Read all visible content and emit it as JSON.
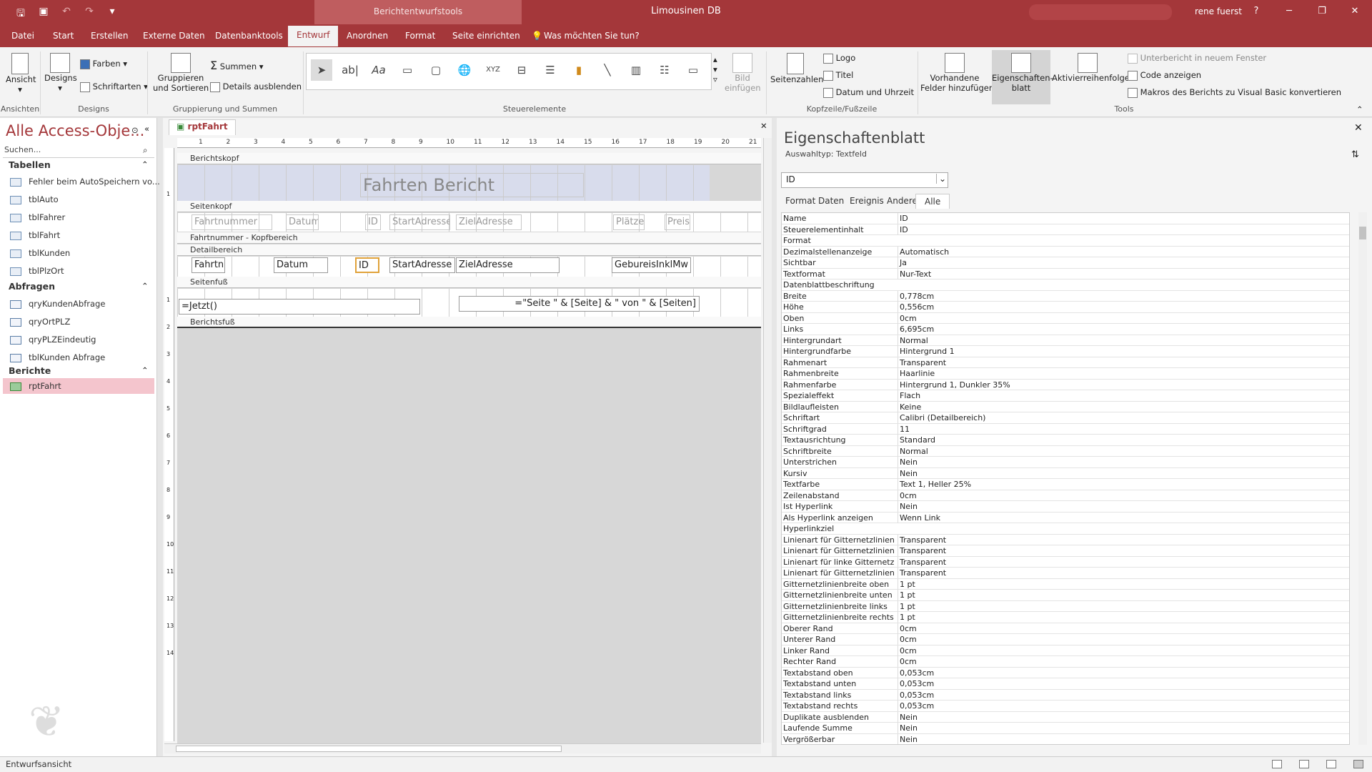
{
  "titlebar": {
    "context_tool": "Berichtentwurfstools",
    "app_title": "Limousinen DB",
    "user": "rene fuerst",
    "help": "?",
    "minimize": "─",
    "restore": "❐",
    "close": "✕"
  },
  "qat": {
    "save": "🖫",
    "form": "▣",
    "undo": "↶",
    "redo": "↷",
    "more": "▾"
  },
  "ribbon_tabs": [
    "Datei",
    "Start",
    "Erstellen",
    "Externe Daten",
    "Datenbanktools",
    "Entwurf",
    "Anordnen",
    "Format",
    "Seite einrichten"
  ],
  "active_tab": "Entwurf",
  "tell_me": "Was möchten Sie tun?",
  "ribbon": {
    "ansicht": "Ansicht",
    "designs": "Designs",
    "farben": "Farben",
    "schriftarten": "Schriftarten",
    "gruppieren": "Gruppieren\nund Sortieren",
    "summen": "Summen",
    "details": "Details ausblenden",
    "bild": "Bild\neinfügen",
    "seitenzahlen": "Seitenzahlen",
    "logo": "Logo",
    "titel": "Titel",
    "datum_uhrzeit": "Datum und Uhrzeit",
    "vorhandene": "Vorhandene\nFelder hinzufügen",
    "eigenschaftenblatt": "Eigenschaften-\nblatt",
    "aktivierreihenfolge": "Aktivierreihenfolge",
    "unterbericht": "Unterbericht in neuem Fenster",
    "code": "Code anzeigen",
    "makros": "Makros des Berichts zu Visual Basic konvertieren",
    "groups": {
      "ansichten": "Ansichten",
      "designs": "Designs",
      "gruppierung": "Gruppierung und Summen",
      "steuerelemente": "Steuerelemente",
      "kopfzeile": "Kopfzeile/Fußzeile",
      "tools": "Tools"
    }
  },
  "nav": {
    "title": "Alle Access-Obje...",
    "search_placeholder": "Suchen...",
    "tabellen_header": "Tabellen",
    "tabellen": [
      "Fehler beim AutoSpeichern vo...",
      "tblAuto",
      "tblFahrer",
      "tblFahrt",
      "tblKunden",
      "tblPlzOrt"
    ],
    "abfragen_header": "Abfragen",
    "abfragen": [
      "qryKundenAbfrage",
      "qryOrtPLZ",
      "qryPLZEindeutig",
      "tblKunden Abfrage"
    ],
    "berichte_header": "Berichte",
    "berichte": [
      "rptFahrt"
    ]
  },
  "document": {
    "tab": "rptFahrt",
    "sections": {
      "berichtskopf": "Berichtskopf",
      "seitenkopf": "Seitenkopf",
      "fahrtnummer_kopf": "Fahrtnummer - Kopfbereich",
      "detail": "Detailbereich",
      "seitenfuss": "Seitenfuß",
      "berichtsfuss": "Berichtsfuß"
    },
    "report_title": "Fahrten Bericht",
    "header_labels": [
      "Fahrtnummer",
      "Datum",
      "ID",
      "StartAdresse",
      "ZielAdresse",
      "Plätze",
      "Preis"
    ],
    "detail_fields": [
      "Fahrtn",
      "Datum",
      "ID",
      "StartAdresse",
      "ZielAdresse",
      "GebureisInklMw"
    ],
    "footer_now": "=Jetzt()",
    "footer_page": "=\"Seite \" & [Seite] & \" von \" & [Seiten]",
    "ruler_numbers": [
      "1",
      "2",
      "3",
      "4",
      "5",
      "6",
      "7",
      "8",
      "9",
      "10",
      "11",
      "12",
      "13",
      "14",
      "15",
      "16",
      "17",
      "18",
      "19",
      "20",
      "21"
    ],
    "ruler_v": [
      "1",
      "1",
      "2",
      "3",
      "4",
      "5",
      "6",
      "7",
      "8",
      "9",
      "10",
      "11",
      "12",
      "13",
      "14"
    ]
  },
  "properties": {
    "title": "Eigenschaftenblatt",
    "selection_type": "Auswahltyp:  Textfeld",
    "selected": "ID",
    "tabs": [
      "Format",
      "Daten",
      "Ereignis",
      "Andere",
      "Alle"
    ],
    "active_tab": "Alle",
    "rows": [
      [
        "Name",
        "ID"
      ],
      [
        "Steuerelementinhalt",
        "ID"
      ],
      [
        "Format",
        ""
      ],
      [
        "Dezimalstellenanzeige",
        "Automatisch"
      ],
      [
        "Sichtbar",
        "Ja"
      ],
      [
        "Textformat",
        "Nur-Text"
      ],
      [
        "Datenblattbeschriftung",
        ""
      ],
      [
        "Breite",
        "0,778cm"
      ],
      [
        "Höhe",
        "0,556cm"
      ],
      [
        "Oben",
        "0cm"
      ],
      [
        "Links",
        "6,695cm"
      ],
      [
        "Hintergrundart",
        "Normal"
      ],
      [
        "Hintergrundfarbe",
        "Hintergrund 1"
      ],
      [
        "Rahmenart",
        "Transparent"
      ],
      [
        "Rahmenbreite",
        "Haarlinie"
      ],
      [
        "Rahmenfarbe",
        "Hintergrund 1, Dunkler 35%"
      ],
      [
        "Spezialeffekt",
        "Flach"
      ],
      [
        "Bildlaufleisten",
        "Keine"
      ],
      [
        "Schriftart",
        "Calibri (Detailbereich)"
      ],
      [
        "Schriftgrad",
        "11"
      ],
      [
        "Textausrichtung",
        "Standard"
      ],
      [
        "Schriftbreite",
        "Normal"
      ],
      [
        "Unterstrichen",
        "Nein"
      ],
      [
        "Kursiv",
        "Nein"
      ],
      [
        "Textfarbe",
        "Text 1, Heller 25%"
      ],
      [
        "Zeilenabstand",
        "0cm"
      ],
      [
        "Ist Hyperlink",
        "Nein"
      ],
      [
        "Als Hyperlink anzeigen",
        "Wenn Link"
      ],
      [
        "Hyperlinkziel",
        ""
      ],
      [
        "Linienart für Gitternetzlinien o",
        "Transparent"
      ],
      [
        "Linienart für Gitternetzlinien u",
        "Transparent"
      ],
      [
        "Linienart für linke Gitternetzlir",
        "Transparent"
      ],
      [
        "Linienart für Gitternetzlinien re",
        "Transparent"
      ],
      [
        "Gitternetzlinienbreite oben",
        "1 pt"
      ],
      [
        "Gitternetzlinienbreite unten",
        "1 pt"
      ],
      [
        "Gitternetzlinienbreite links",
        "1 pt"
      ],
      [
        "Gitternetzlinienbreite rechts",
        "1 pt"
      ],
      [
        "Oberer Rand",
        "0cm"
      ],
      [
        "Unterer Rand",
        "0cm"
      ],
      [
        "Linker Rand",
        "0cm"
      ],
      [
        "Rechter Rand",
        "0cm"
      ],
      [
        "Textabstand oben",
        "0,053cm"
      ],
      [
        "Textabstand unten",
        "0,053cm"
      ],
      [
        "Textabstand links",
        "0,053cm"
      ],
      [
        "Textabstand rechts",
        "0,053cm"
      ],
      [
        "Duplikate ausblenden",
        "Nein"
      ],
      [
        "Laufende Summe",
        "Nein"
      ],
      [
        "Vergrößerbar",
        "Nein"
      ]
    ]
  },
  "status": "Entwurfsansicht",
  "colors": {
    "accent": "#a4373a",
    "selection": "#f4c5cd",
    "context_tab": "#bf5d5f"
  }
}
